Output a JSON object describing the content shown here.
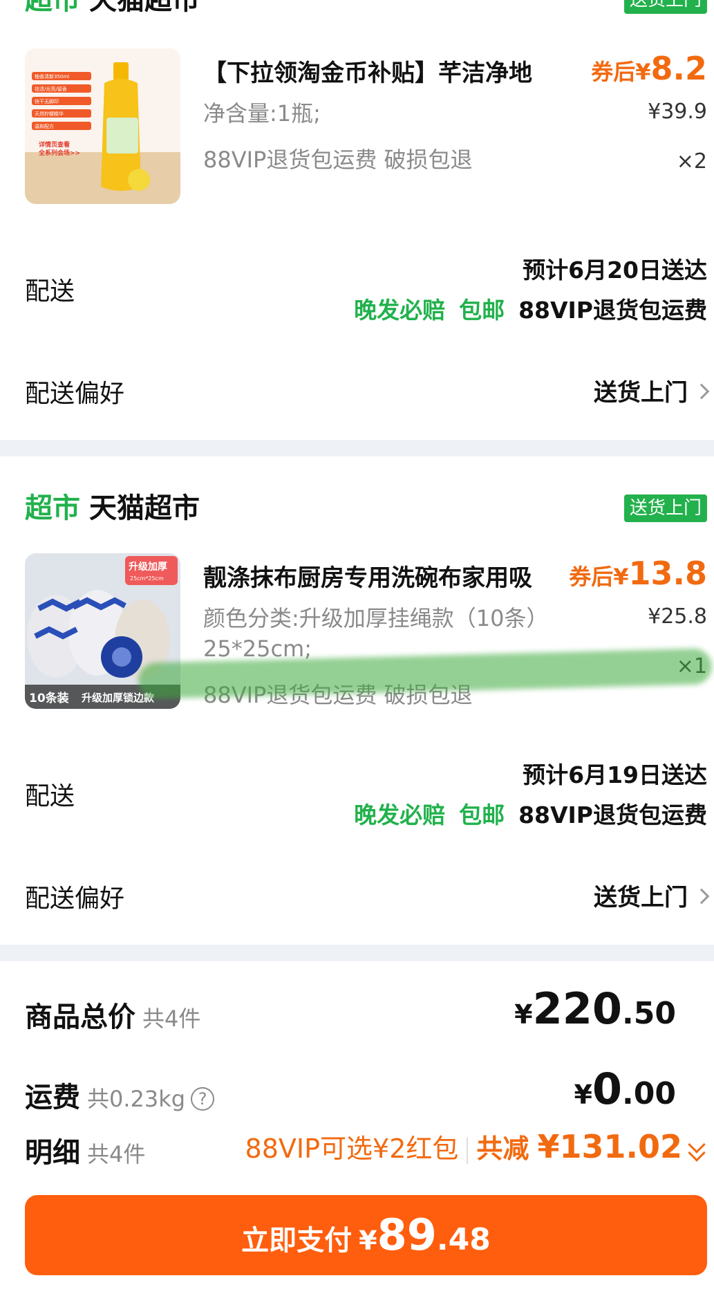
{
  "store": {
    "tag": "超市",
    "name": "天猫超市",
    "badge": "送货上门"
  },
  "order1": {
    "product": {
      "title": "【下拉领淘金币补贴】芊洁净地",
      "coupon_label": "券后",
      "coupon_currency": "¥",
      "coupon_price": "8.2",
      "spec": "净含量:1瓶;",
      "orig_price": "¥39.9",
      "service": "88VIP退货包运费  破损包退",
      "qty": "×2",
      "image_text": [
        "柚香清新350ml",
        "祛渍/光亮/留香",
        "快干无脚印",
        "天然柠檬精华",
        "温和配方",
        "详情页查看",
        "全系列会场>>"
      ]
    },
    "delivery": {
      "label": "配送",
      "eta": "预计6月20日送达",
      "tag1": "晚发必赔",
      "tag2": "包邮",
      "tag3": "88VIP退货包运费"
    },
    "pref": {
      "label": "配送偏好",
      "value": "送货上门"
    }
  },
  "order2": {
    "store": {
      "tag": "超市",
      "name": "天猫超市",
      "badge": "送货上门"
    },
    "product": {
      "title": "靓涤抹布厨房专用洗碗布家用吸",
      "coupon_label": "券后",
      "coupon_currency": "¥",
      "coupon_price": "13.8",
      "spec": "颜色分类:升级加厚挂绳款（10条）25*25cm;",
      "orig_price": "¥25.8",
      "service": "88VIP退货包运费  破损包退",
      "qty": "×1",
      "image_badge": "升级加厚",
      "image_badge_sub": "25cm*25cm",
      "image_count": "10条装",
      "image_caption": "升级加厚锁边款"
    },
    "delivery": {
      "label": "配送",
      "eta": "预计6月19日送达",
      "tag1": "晚发必赔",
      "tag2": "包邮",
      "tag3": "88VIP退货包运费"
    },
    "pref": {
      "label": "配送偏好",
      "value": "送货上门"
    }
  },
  "summary": {
    "goods_label": "商品总价",
    "goods_count": "共4件",
    "goods_currency": "¥",
    "goods_int": "220",
    "goods_dec": ".50",
    "shipping_label": "运费",
    "shipping_weight": "共0.23kg",
    "shipping_help": "?",
    "shipping_currency": "¥",
    "shipping_int": "0",
    "shipping_dec": ".00",
    "detail_label": "明细",
    "detail_count": "共4件",
    "redpacket": "88VIP可选¥2红包",
    "discount_label": "共减",
    "discount_value": "¥131.02"
  },
  "pay": {
    "label": "立即支付",
    "currency": "¥",
    "int": "89",
    "dec": ".48"
  },
  "colors": {
    "brand_orange": "#ff5e0e",
    "price_orange": "#f26a10",
    "green": "#22b14c"
  }
}
